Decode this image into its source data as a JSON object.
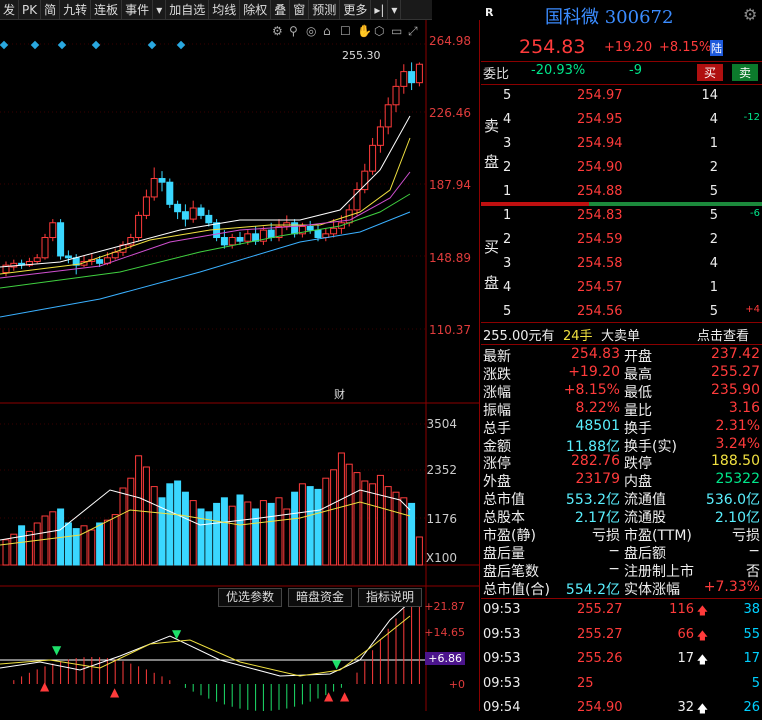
{
  "toolbar": {
    "items": [
      "发",
      "PK",
      "简",
      "九转",
      "连板",
      "事件",
      "▾",
      "加自选",
      "均线",
      "除权",
      "叠",
      "窗",
      "预测",
      "更多",
      "▸|",
      "▾"
    ]
  },
  "chart": {
    "price_axis": [
      "264.98",
      "226.46",
      "187.94",
      "148.89",
      "110.37"
    ],
    "high_label": "255.30",
    "event_marker": "财",
    "volume_axis": [
      "3504",
      "2352",
      "1176",
      "X100"
    ],
    "macd_axis": [
      "+21.87",
      "+14.65",
      "+6.86",
      "+0"
    ],
    "ind_buttons": [
      "优选参数",
      "暗盘资金",
      "指标说明"
    ]
  },
  "stock": {
    "name": "国科微",
    "code": "300672",
    "price": "254.83",
    "change": "+19.20",
    "pct": "+8.15%",
    "flag": "陆",
    "r": "R"
  },
  "weibi": {
    "label": "委比",
    "value": "-20.93%",
    "diff": "-9",
    "buy": "买",
    "sell": "卖"
  },
  "sell": [
    {
      "lvl": "5",
      "price": "254.97",
      "vol": "14",
      "chg": ""
    },
    {
      "lvl": "4",
      "price": "254.95",
      "vol": "4",
      "chg": "-12"
    },
    {
      "lvl": "3",
      "price": "254.94",
      "vol": "1",
      "chg": ""
    },
    {
      "lvl": "2",
      "price": "254.90",
      "vol": "2",
      "chg": ""
    },
    {
      "lvl": "1",
      "price": "254.88",
      "vol": "5",
      "chg": ""
    }
  ],
  "sell_label": [
    "卖",
    "盘"
  ],
  "buy": [
    {
      "lvl": "1",
      "price": "254.83",
      "vol": "5",
      "chg": "-6"
    },
    {
      "lvl": "2",
      "price": "254.59",
      "vol": "2",
      "chg": ""
    },
    {
      "lvl": "3",
      "price": "254.58",
      "vol": "4",
      "chg": ""
    },
    {
      "lvl": "4",
      "price": "254.57",
      "vol": "1",
      "chg": ""
    },
    {
      "lvl": "5",
      "price": "254.56",
      "vol": "5",
      "chg": "+4"
    }
  ],
  "buy_label": [
    "买",
    "盘"
  ],
  "bigorder": {
    "price": "255.00元有",
    "qty": "24手",
    "label": "大卖单",
    "link": "点击查看"
  },
  "stats": [
    [
      "最新",
      "254.83",
      "开盘",
      "237.42"
    ],
    [
      "涨跌",
      "+19.20",
      "最高",
      "255.27"
    ],
    [
      "涨幅",
      "+8.15%",
      "最低",
      "235.90"
    ],
    [
      "振幅",
      "8.22%",
      "量比",
      "3.16"
    ],
    [
      "总手",
      "48501",
      "换手",
      "2.31%"
    ],
    [
      "金额",
      "11.88亿",
      "换手(实)",
      "3.24%"
    ],
    [
      "涨停",
      "282.76",
      "跌停",
      "188.50"
    ],
    [
      "外盘",
      "23179",
      "内盘",
      "25322"
    ],
    [
      "总市值",
      "553.2亿",
      "流通值",
      "536.0亿"
    ],
    [
      "总股本",
      "2.17亿",
      "流通股",
      "2.10亿"
    ],
    [
      "市盈(静)",
      "亏损",
      "市盈(TTM)",
      "亏损"
    ],
    [
      "盘后量",
      "−",
      "盘后额",
      "−"
    ],
    [
      "盘后笔数",
      "−",
      "注册制上市",
      "否"
    ],
    [
      "总市值(合)",
      "554.2亿",
      "实体涨幅",
      "+7.33%"
    ]
  ],
  "ticks": [
    {
      "time": "09:53",
      "price": "255.27",
      "vol": "116",
      "cnt": "38",
      "dir": "up"
    },
    {
      "time": "09:53",
      "price": "255.27",
      "vol": "66",
      "cnt": "55",
      "dir": "up"
    },
    {
      "time": "09:53",
      "price": "255.26",
      "vol": "17",
      "cnt": "17",
      "dir": "neutral"
    },
    {
      "time": "09:53",
      "price": "25",
      "vol": "",
      "cnt": "5",
      "dir": ""
    },
    {
      "time": "09:54",
      "price": "254.90",
      "vol": "32",
      "cnt": "26",
      "dir": "neutral"
    }
  ]
}
